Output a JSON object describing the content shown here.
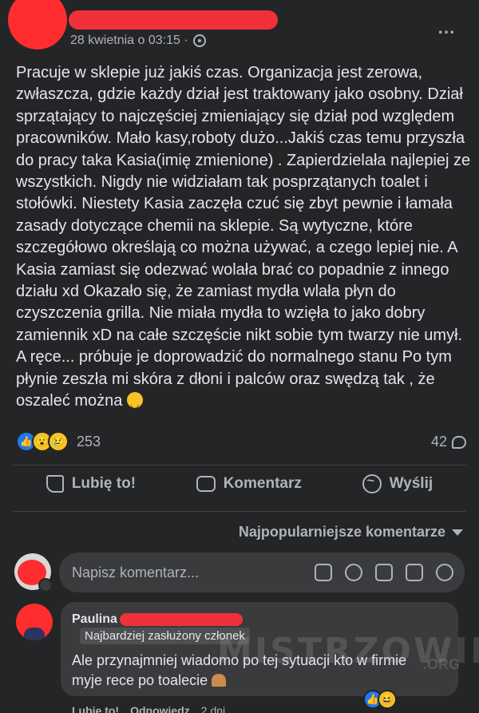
{
  "post": {
    "timestamp": "28 kwietnia o 03:15 ·",
    "privacy_icon": "globe-icon",
    "more_icon": "⋯",
    "text": "Pracuje w sklepie już jakiś czas. Organizacja jest zerowa, zwłaszcza, gdzie każdy dział jest traktowany jako osobny. Dział sprzątający to najczęściej zmieniający się dział pod względem pracowników. Mało kasy,roboty dużo...Jakiś czas temu przyszła do pracy taka Kasia(imię zmienione) . Zapierdzielała najlepiej ze wszystkich. Nigdy nie widziałam tak posprzątanych toalet i stołówki. Niestety Kasia zaczęła czuć się zbyt pewnie i łamała zasady dotyczące chemii na sklepie. Są wytyczne, które szczegółowo określają co można używać, a czego lepiej nie. A Kasia zamiast się odezwać wolała brać co popadnie z innego działu xd Okazało się, że zamiast mydła wlała płyn do czyszczenia grilla. Nie miała mydła to wzięła to jako dobry zamiennik xD na całe szczęście nikt sobie tym twarzy nie umył. A ręce... próbuje je doprowadzić do normalnego stanu Po tym płynie zeszła mi skóra z dłoni i palców oraz swędzą tak , że oszaleć można",
    "reaction_count": "253",
    "comment_count": "42"
  },
  "actions": {
    "like": "Lubię to!",
    "comment": "Komentarz",
    "send": "Wyślij"
  },
  "sort_label": "Najpopularniejsze komentarze",
  "comment_input": {
    "placeholder": "Napisz komentarz..."
  },
  "comment": {
    "author": "Paulina",
    "badge": "Najbardziej zasłużony członek",
    "text": "Ale przynajmniej wiadomo po tej sytuacji kto w firmie myje rece po toalecie",
    "like": "Lubię to!",
    "reply": "Odpowiedz",
    "time": "2 dni"
  },
  "watermark": {
    "main": "MISTRZOWIE",
    "sub": ".ORG"
  },
  "colors": {
    "background": "#242526",
    "redaction": "#f0303a",
    "like_blue": "#2078f4"
  }
}
